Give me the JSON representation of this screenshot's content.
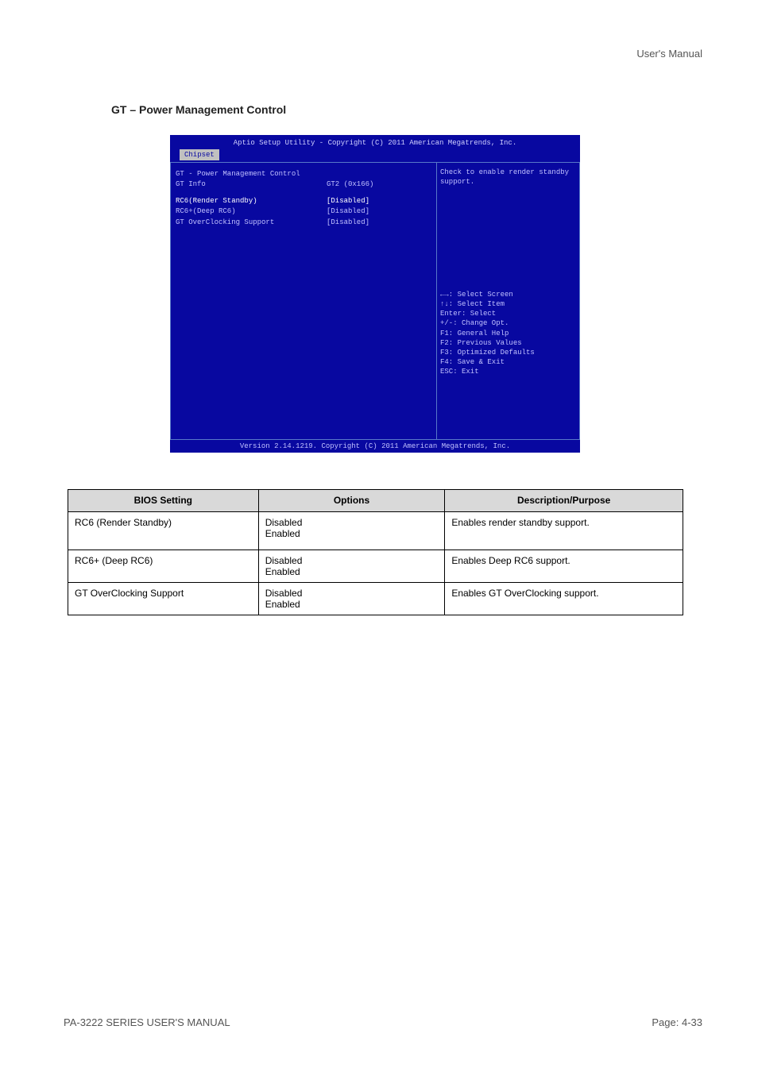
{
  "header_right": "User's Manual",
  "section_title": "GT – Power Management Control",
  "bios": {
    "title": "Aptio Setup Utility - Copyright (C) 2011 American Megatrends, Inc.",
    "tab": "Chipset",
    "left": {
      "heading": "GT - Power Management Control",
      "gtinfo_label": "GT Info",
      "gtinfo_value": "GT2 (0x166)",
      "rc6_label": "RC6(Render Standby)",
      "rc6_value": "[Disabled]",
      "rc6p_label": "RC6+(Deep RC6)",
      "rc6p_value": "[Disabled]",
      "gtoc_label": "GT OverClocking Support",
      "gtoc_value": "[Disabled]"
    },
    "right": {
      "desc1": "Check to enable render standby",
      "desc2": "support.",
      "help1": "←→: Select Screen",
      "help2": "↑↓: Select Item",
      "help3": "Enter: Select",
      "help4": "+/-: Change Opt.",
      "help5": "F1: General Help",
      "help6": "F2: Previous Values",
      "help7": "F3: Optimized Defaults",
      "help8": "F4: Save & Exit",
      "help9": "ESC: Exit"
    },
    "footer": "Version 2.14.1219. Copyright (C) 2011 American Megatrends, Inc."
  },
  "table": {
    "h1": "BIOS Setting",
    "h2": "Options",
    "h3": "Description/Purpose",
    "r1c1": "RC6 (Render Standby)",
    "r1c2a": "Disabled",
    "r1c2b": "Enabled",
    "r1c3": "Enables render standby support.",
    "r2c1": "RC6+ (Deep RC6)",
    "r2c2a": "Disabled",
    "r2c2b": "Enabled",
    "r2c3": "Enables Deep RC6 support.",
    "r3c1": "GT OverClocking Support",
    "r3c2a": "Disabled",
    "r3c2b": "Enabled",
    "r3c3": "Enables GT OverClocking support."
  },
  "footer_left": "PA-3222 SERIES USER'S MANUAL",
  "footer_right": "Page: 4-33"
}
